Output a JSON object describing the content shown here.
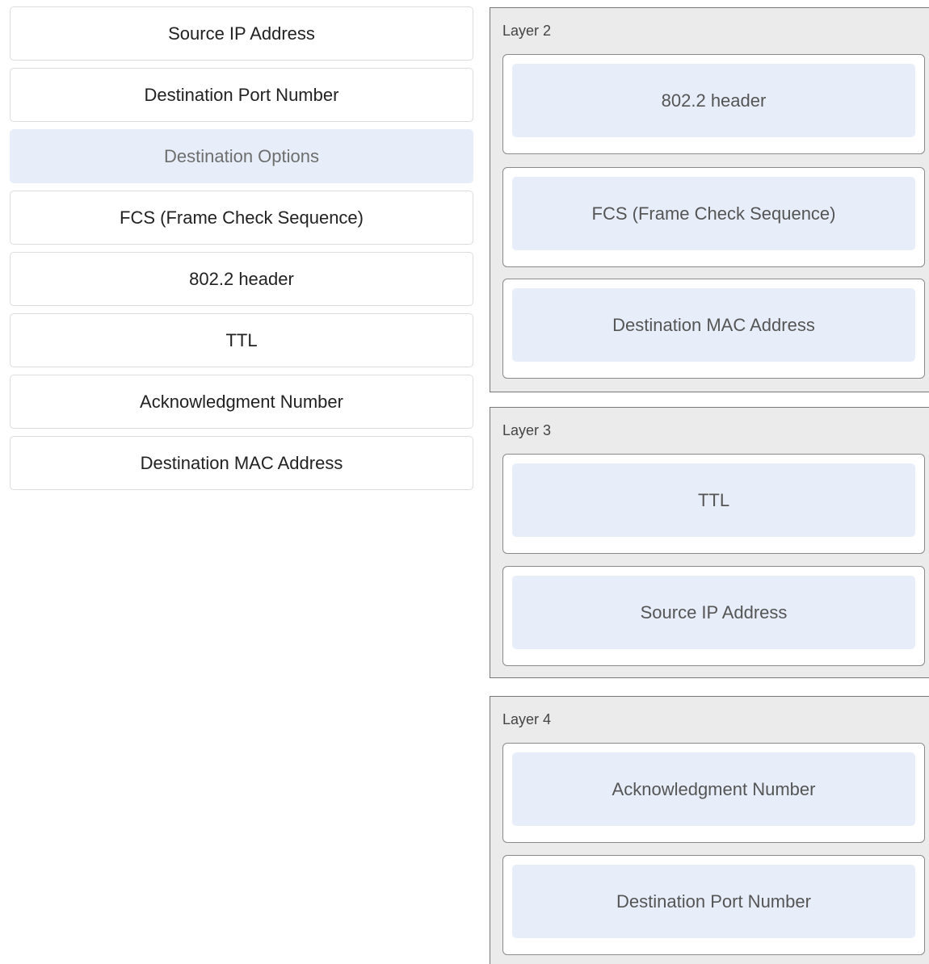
{
  "source_items": [
    {
      "label": "Source IP Address",
      "placed": false
    },
    {
      "label": "Destination Port Number",
      "placed": false
    },
    {
      "label": "Destination Options",
      "placed": true
    },
    {
      "label": "FCS (Frame Check Sequence)",
      "placed": false
    },
    {
      "label": "802.2 header",
      "placed": false
    },
    {
      "label": "TTL",
      "placed": false
    },
    {
      "label": "Acknowledgment Number",
      "placed": false
    },
    {
      "label": "Destination MAC Address",
      "placed": false
    }
  ],
  "layers": [
    {
      "title": "Layer 2",
      "slots": [
        "802.2 header",
        "FCS (Frame Check Sequence)",
        "Destination MAC Address"
      ]
    },
    {
      "title": "Layer 3",
      "slots": [
        "TTL",
        "Source IP Address"
      ]
    },
    {
      "title": "Layer 4",
      "slots": [
        "Acknowledgment Number",
        "Destination Port Number"
      ]
    }
  ]
}
